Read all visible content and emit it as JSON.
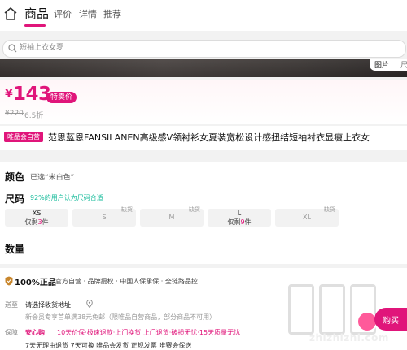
{
  "nav": {
    "tabs": [
      {
        "label": "商品",
        "active": true
      },
      {
        "label": "评价"
      },
      {
        "label": "详情"
      },
      {
        "label": "推荐"
      }
    ]
  },
  "search": {
    "placeholder": "短袖上衣女夏"
  },
  "image_tabs": [
    "图片",
    "尺"
  ],
  "price": {
    "currency": "¥",
    "current": "143",
    "badge": "特卖价",
    "original": "¥220",
    "discount": "6.5折"
  },
  "product": {
    "store_badge": "唯品会自营",
    "title": "范思蓝恩FANSILANEN高级感V领衬衫女夏装宽松设计感扭结短袖衬衣显瘦上衣女"
  },
  "color": {
    "label": "颜色",
    "selected": "已选“米白色”"
  },
  "size": {
    "label": "尺码",
    "hint": "92%的用户认为尺码合适",
    "options": [
      {
        "name": "XS",
        "stock_prefix": "仅剩",
        "stock_count": "3",
        "stock_suffix": "件",
        "out_label": ""
      },
      {
        "name": "S",
        "stock_prefix": "",
        "stock_count": "",
        "stock_suffix": "",
        "out_label": "缺货"
      },
      {
        "name": "M",
        "stock_prefix": "",
        "stock_count": "",
        "stock_suffix": "",
        "out_label": "缺货"
      },
      {
        "name": "L",
        "stock_prefix": "仅剩",
        "stock_count": "9",
        "stock_suffix": "件",
        "out_label": ""
      },
      {
        "name": "XL",
        "stock_prefix": "",
        "stock_count": "",
        "stock_suffix": "",
        "out_label": "缺货"
      }
    ]
  },
  "quantity": {
    "label": "数量"
  },
  "guarantee": {
    "title": "100%正品",
    "text": "官方自营 · 品牌授权 · 中国人保承保 · 全链路品控"
  },
  "delivery": {
    "label": "送至",
    "address": "请选择收货地址",
    "sub": "新会员专享首单满38元免邮（限唯品自营商品，部分商品不可用）"
  },
  "assurance": {
    "label": "保障",
    "badge": "安心购",
    "text": "10天价保·极速退款·上门换货·上门退货·破损无忧·15天质量无忧",
    "last": "7天无理由退货   7天可换   唯品会发货   正规发票   唯赛会保送"
  },
  "watermark": {
    "text": "zhizhizhi.com"
  },
  "fab": {
    "label": "购买"
  },
  "colors": {
    "accent": "#e0157a",
    "hint": "#1abc9c"
  }
}
